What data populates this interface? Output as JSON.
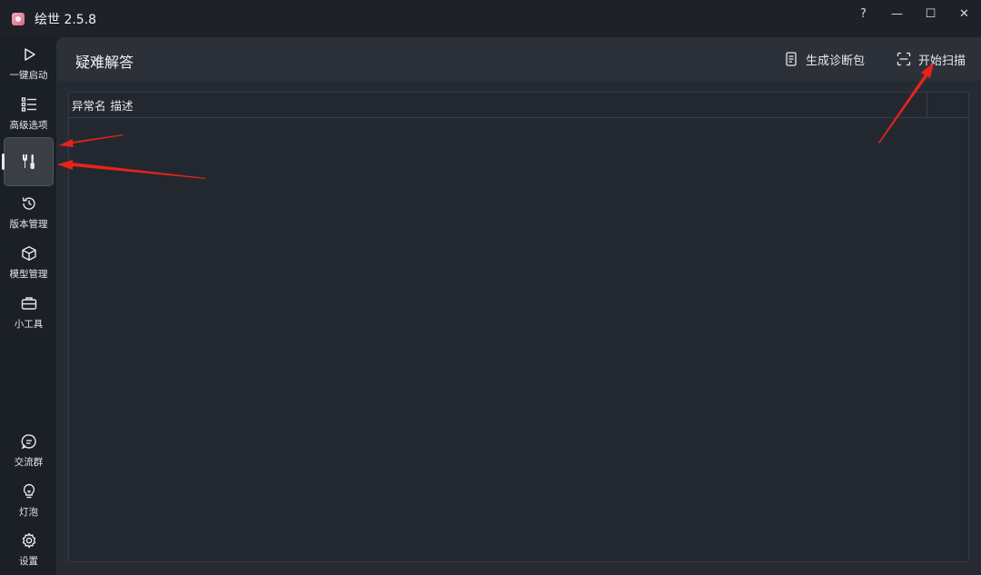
{
  "window": {
    "title": "绘世 2.5.8",
    "controls": {
      "help": "?",
      "minimize": "—",
      "maximize": "☐",
      "close": "✕"
    }
  },
  "sidebar": {
    "items": [
      {
        "label": "一键启动",
        "icon": "play-icon"
      },
      {
        "label": "高级选项",
        "icon": "list-icon"
      },
      {
        "label": "",
        "icon": "tools-icon",
        "active": true
      },
      {
        "label": "版本管理",
        "icon": "history-icon"
      },
      {
        "label": "模型管理",
        "icon": "cube-icon"
      },
      {
        "label": "小工具",
        "icon": "toolbox-icon"
      }
    ],
    "bottom_items": [
      {
        "label": "交流群",
        "icon": "chat-icon"
      },
      {
        "label": "灯泡",
        "icon": "lightbulb-icon"
      },
      {
        "label": "设置",
        "icon": "gear-icon"
      }
    ]
  },
  "main": {
    "title": "疑难解答",
    "actions": {
      "diagnose_label": "生成诊断包",
      "scan_label": "开始扫描"
    },
    "table": {
      "columns": [
        "异常名",
        "描述"
      ],
      "rows": []
    }
  },
  "colors": {
    "annotation_arrow": "#e8231a",
    "background": "#1b1f26",
    "panel": "#262b33"
  }
}
